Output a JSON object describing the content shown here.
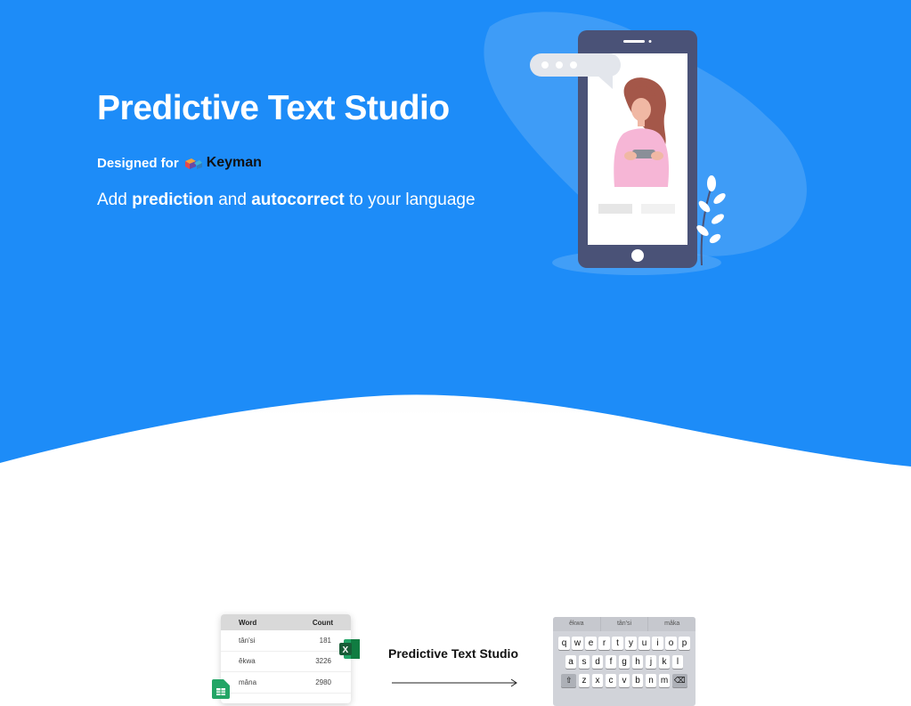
{
  "hero": {
    "title": "Predictive Text Studio",
    "designed_for": "Designed for",
    "keyman": "Keyman",
    "tagline_parts": [
      "Add ",
      "prediction",
      " and ",
      "autocorrect",
      " to your language"
    ]
  },
  "colors": {
    "hero_blue": "#1d8cf8",
    "accent_blue_light": "#5aaaf6",
    "phone_frame": "#4a5277"
  },
  "demo": {
    "sheet": {
      "headers": [
        "Word",
        "Count"
      ],
      "rows": [
        [
          "tân'si",
          "181"
        ],
        [
          "êkwa",
          "3226"
        ],
        [
          "mâna",
          "2980"
        ]
      ]
    },
    "arrow_label": "Predictive Text Studio",
    "keyboard": {
      "suggestions": [
        "êkwa",
        "tân'si",
        "mâka"
      ],
      "rows": [
        [
          "q",
          "w",
          "e",
          "r",
          "t",
          "y",
          "u",
          "i",
          "o",
          "p"
        ],
        [
          "a",
          "s",
          "d",
          "f",
          "g",
          "h",
          "j",
          "k",
          "l"
        ],
        [
          "z",
          "x",
          "c",
          "v",
          "b",
          "n",
          "m"
        ]
      ],
      "shift": "⇧",
      "backspace": "⌫"
    },
    "icons": [
      "excel-icon",
      "google-sheets-icon"
    ]
  }
}
